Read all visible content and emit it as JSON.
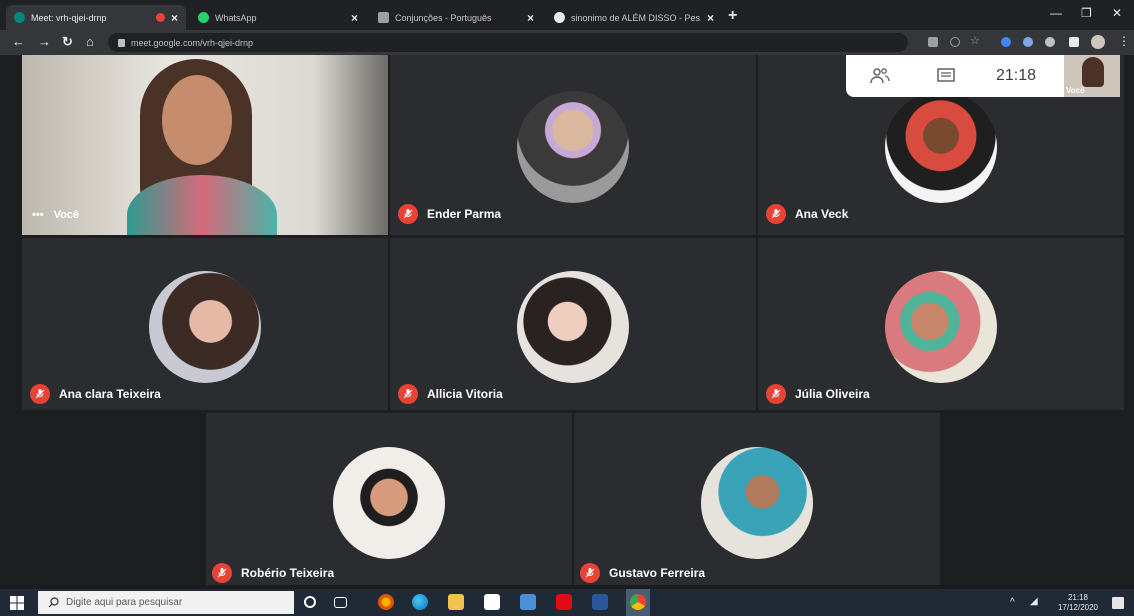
{
  "browser": {
    "tabs": [
      {
        "label": "Meet: vrh-qjei-drnp",
        "fav_color": "#00897b",
        "active": true
      },
      {
        "label": "WhatsApp",
        "fav_color": "#25d366",
        "active": false
      },
      {
        "label": "Conjunções - Português",
        "fav_color": "#9aa0a6",
        "active": false
      },
      {
        "label": "sinonimo de ALÉM DISSO - Pes...",
        "fav_color": "#e8eaed",
        "active": false
      }
    ],
    "url": "meet.google.com/vrh-qjei-drnp"
  },
  "meet": {
    "self_label": "Você",
    "clock": "21:18",
    "thumb_label": "Você",
    "participants": [
      {
        "name": "Ender Parma",
        "muted": true
      },
      {
        "name": "Ana Veck",
        "muted": true
      },
      {
        "name": "Ana clara Teixeira",
        "muted": true
      },
      {
        "name": "Allicia Vitoria",
        "muted": true
      },
      {
        "name": "Júlia Oliveira",
        "muted": true
      },
      {
        "name": "Robério Teixeira",
        "muted": true
      },
      {
        "name": "Gustavo Ferreira",
        "muted": true
      }
    ]
  },
  "taskbar": {
    "search_placeholder": "Digite aqui para pesquisar",
    "time": "21:18",
    "date": "17/12/2020"
  },
  "colors": {
    "muted_red": "#ea4335",
    "tile_bg": "#2b2c2f",
    "stage_bg": "#1d1e20"
  }
}
